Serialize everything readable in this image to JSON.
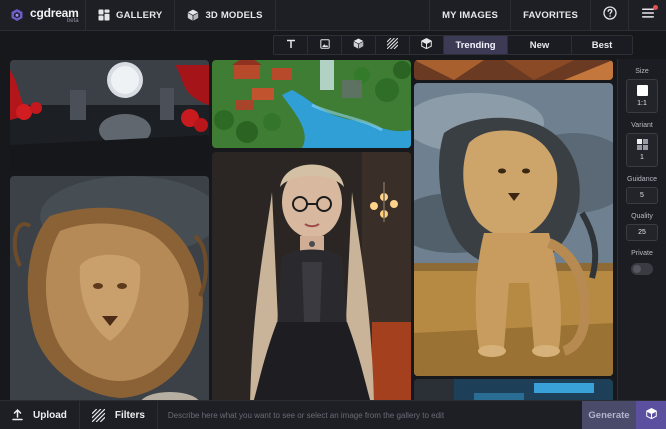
{
  "header": {
    "logo_name": "cgdream",
    "logo_beta": "beta",
    "gallery_label": "GALLERY",
    "models_label": "3D MODELS",
    "my_images_label": "MY IMAGES",
    "favorites_label": "FAVORITES"
  },
  "filters": {
    "type_icons": [
      "text-icon",
      "image-icon",
      "cube-icon",
      "hatch-icon",
      "3d-model-icon"
    ],
    "sort_tabs": [
      "Trending",
      "New",
      "Best"
    ],
    "active_sort": "Trending"
  },
  "gallery": {
    "images": [
      "red-trees-corridor-with-round-window",
      "fantasy-village-by-river",
      "lion-with-wind-blown-mane",
      "gothic-woman-with-glasses-in-corset",
      "lion-sitting-in-savanna"
    ]
  },
  "side_panel": {
    "size_label": "Size",
    "size_value": "1:1",
    "variant_label": "Variant",
    "variant_value": "1",
    "guidance_label": "Guidance",
    "guidance_value": "5",
    "quality_label": "Quality",
    "quality_value": "25",
    "private_label": "Private"
  },
  "bottom": {
    "upload_label": "Upload",
    "filters_label": "Filters",
    "prompt_placeholder": "Describe here what you want to see or select an image from the gallery to edit",
    "generate_label": "Generate"
  },
  "colors": {
    "background": "#17181c",
    "bar": "#1e1f24",
    "active_tab": "#3b3b55",
    "generate": "#4a4a6a",
    "accent": "#5b4fa0",
    "notification": "#e05252"
  }
}
